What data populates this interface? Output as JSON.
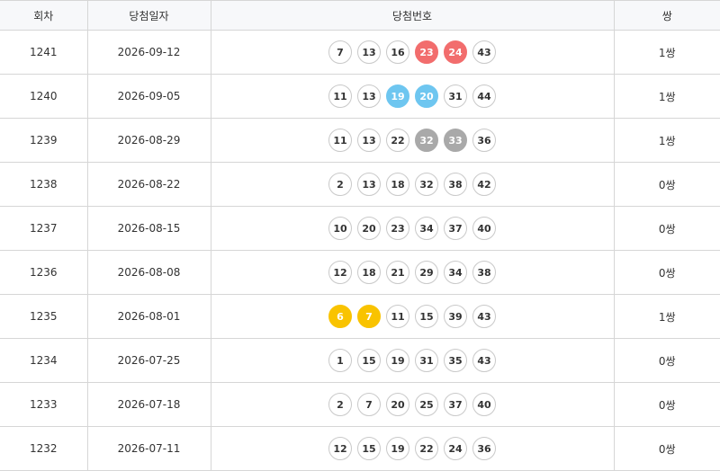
{
  "headers": {
    "round": "회차",
    "date": "당첨일자",
    "numbers": "당첨번호",
    "pair": "쌍"
  },
  "colors": {
    "red": "#f26d6d",
    "blue": "#6ec6f0",
    "gray": "#a9a9a9",
    "yellow": "#f9c300"
  },
  "rows": [
    {
      "round": "1241",
      "date": "2026-09-12",
      "pair": "1쌍",
      "balls": [
        {
          "n": "7"
        },
        {
          "n": "13"
        },
        {
          "n": "16"
        },
        {
          "n": "23",
          "c": "red"
        },
        {
          "n": "24",
          "c": "red"
        },
        {
          "n": "43"
        }
      ]
    },
    {
      "round": "1240",
      "date": "2026-09-05",
      "pair": "1쌍",
      "balls": [
        {
          "n": "11"
        },
        {
          "n": "13"
        },
        {
          "n": "19",
          "c": "blue"
        },
        {
          "n": "20",
          "c": "blue"
        },
        {
          "n": "31"
        },
        {
          "n": "44"
        }
      ]
    },
    {
      "round": "1239",
      "date": "2026-08-29",
      "pair": "1쌍",
      "balls": [
        {
          "n": "11"
        },
        {
          "n": "13"
        },
        {
          "n": "22"
        },
        {
          "n": "32",
          "c": "gray"
        },
        {
          "n": "33",
          "c": "gray"
        },
        {
          "n": "36"
        }
      ]
    },
    {
      "round": "1238",
      "date": "2026-08-22",
      "pair": "0쌍",
      "balls": [
        {
          "n": "2"
        },
        {
          "n": "13"
        },
        {
          "n": "18"
        },
        {
          "n": "32"
        },
        {
          "n": "38"
        },
        {
          "n": "42"
        }
      ]
    },
    {
      "round": "1237",
      "date": "2026-08-15",
      "pair": "0쌍",
      "balls": [
        {
          "n": "10"
        },
        {
          "n": "20"
        },
        {
          "n": "23"
        },
        {
          "n": "34"
        },
        {
          "n": "37"
        },
        {
          "n": "40"
        }
      ]
    },
    {
      "round": "1236",
      "date": "2026-08-08",
      "pair": "0쌍",
      "balls": [
        {
          "n": "12"
        },
        {
          "n": "18"
        },
        {
          "n": "21"
        },
        {
          "n": "29"
        },
        {
          "n": "34"
        },
        {
          "n": "38"
        }
      ]
    },
    {
      "round": "1235",
      "date": "2026-08-01",
      "pair": "1쌍",
      "balls": [
        {
          "n": "6",
          "c": "yellow"
        },
        {
          "n": "7",
          "c": "yellow"
        },
        {
          "n": "11"
        },
        {
          "n": "15"
        },
        {
          "n": "39"
        },
        {
          "n": "43"
        }
      ]
    },
    {
      "round": "1234",
      "date": "2026-07-25",
      "pair": "0쌍",
      "balls": [
        {
          "n": "1"
        },
        {
          "n": "15"
        },
        {
          "n": "19"
        },
        {
          "n": "31"
        },
        {
          "n": "35"
        },
        {
          "n": "43"
        }
      ]
    },
    {
      "round": "1233",
      "date": "2026-07-18",
      "pair": "0쌍",
      "balls": [
        {
          "n": "2"
        },
        {
          "n": "7"
        },
        {
          "n": "20"
        },
        {
          "n": "25"
        },
        {
          "n": "37"
        },
        {
          "n": "40"
        }
      ]
    },
    {
      "round": "1232",
      "date": "2026-07-11",
      "pair": "0쌍",
      "balls": [
        {
          "n": "12"
        },
        {
          "n": "15"
        },
        {
          "n": "19"
        },
        {
          "n": "22"
        },
        {
          "n": "24"
        },
        {
          "n": "36"
        }
      ]
    }
  ]
}
